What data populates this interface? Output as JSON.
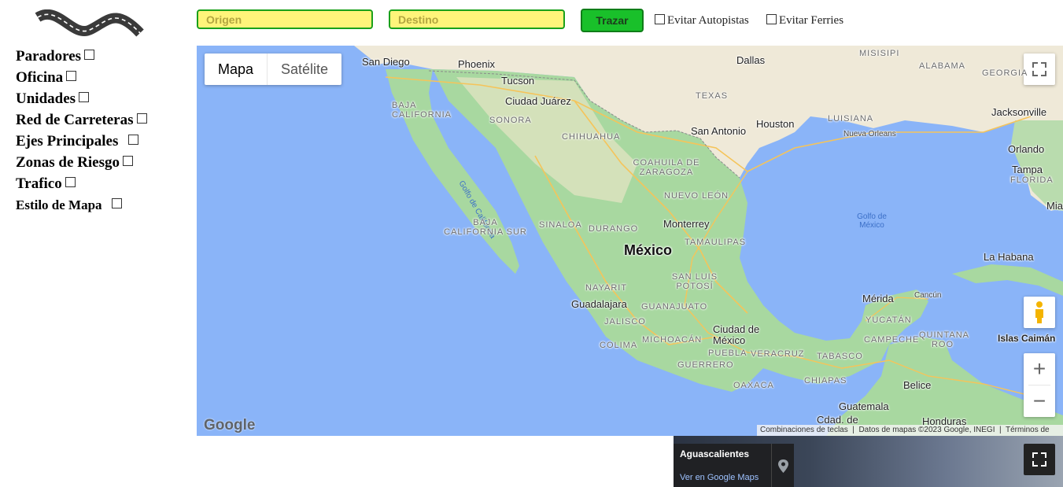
{
  "sidebar": {
    "items": [
      {
        "label": "Paradores"
      },
      {
        "label": "Oficina"
      },
      {
        "label": "Unidades"
      },
      {
        "label": "Red de Carreteras"
      },
      {
        "label": "Ejes Principales"
      },
      {
        "label": "Zonas de Riesgo"
      },
      {
        "label": "Trafico"
      },
      {
        "label": "Estilo de Mapa"
      }
    ]
  },
  "route": {
    "origin_placeholder": "Origen",
    "destination_placeholder": "Destino",
    "trace_label": "Trazar",
    "avoid_highways_label": "Evitar Autopistas",
    "avoid_ferries_label": "Evitar Ferries"
  },
  "map": {
    "type_map_label": "Mapa",
    "type_satellite_label": "Satélite",
    "logo_text": "Google",
    "attribution": {
      "shortcuts": "Combinaciones de teclas",
      "data": "Datos de mapas ©2023 Google, INEGI",
      "terms": "Términos de uso"
    },
    "labels": {
      "san_diego": "San Diego",
      "phoenix": "Phoenix",
      "tucson": "Tucson",
      "ciudad_juarez": "Ciudad Juárez",
      "dallas": "Dallas",
      "misisipi": "MISISIPI",
      "alabama": "ALABAMA",
      "georgia": "GEORGIA",
      "texas": "TEXAS",
      "jacksonville": "Jacksonville",
      "luisiana": "LUISIANA",
      "houston": "Houston",
      "san_antonio": "San Antonio",
      "nueva_orleans": "Nueva Orleans",
      "baja_california": "BAJA CALIFORNIA",
      "sonora": "SONORA",
      "chihuahua": "CHIHUAHUA",
      "orlando": "Orlando",
      "tampa": "Tampa",
      "florida": "FLORIDA",
      "coahuila": "COAHUILA DE ZARAGOZA",
      "golfo_california": "Golfo de California",
      "nuevo_leon": "NUEVO LEÓN",
      "miami": "Miami",
      "golfo_mexico": "Golfo de México",
      "sinaloa": "SINALOA",
      "durango": "DURANGO",
      "monterrey": "Monterrey",
      "baja_california_sur": "BAJA CALIFORNIA SUR",
      "tamaulipas": "TAMAULIPAS",
      "mexico": "México",
      "la_habana": "La Habana",
      "san_luis": "SAN LUIS POTOSÍ",
      "nayarit": "NAYARIT",
      "guadalajara": "Guadalajara",
      "guanajuato": "GUANAJUATO",
      "merida": "Mérida",
      "cancun": "Cancún",
      "yucatan": "YUCATÁN",
      "jalisco": "JALISCO",
      "ciudad_de_mexico": "Ciudad de México",
      "quintana_roo": "QUINTANA ROO",
      "islas_caiman": "Islas Caimán",
      "colima": "COLIMA",
      "michoacan": "MICHOACÁN",
      "campeche": "CAMPECHE",
      "puebla": "PUEBLA",
      "veracruz": "VERACRUZ",
      "tabasco": "TABASCO",
      "guerrero": "GUERRERO",
      "oaxaca": "OAXACA",
      "chiapas": "CHIAPAS",
      "belice": "Belice",
      "guatemala": "Guatemala",
      "honduras": "Honduras",
      "cdad_de": "Cdad. de"
    }
  },
  "street_view": {
    "title": "Aguascalientes",
    "link": "Ver en Google Maps"
  },
  "colors": {
    "field_bg": "#fff47a",
    "field_border": "#1aa01a",
    "button_bg": "#19c02a",
    "water": "#8ab4f8",
    "land": "#a8d8a0",
    "north_land": "#efe9d8"
  }
}
